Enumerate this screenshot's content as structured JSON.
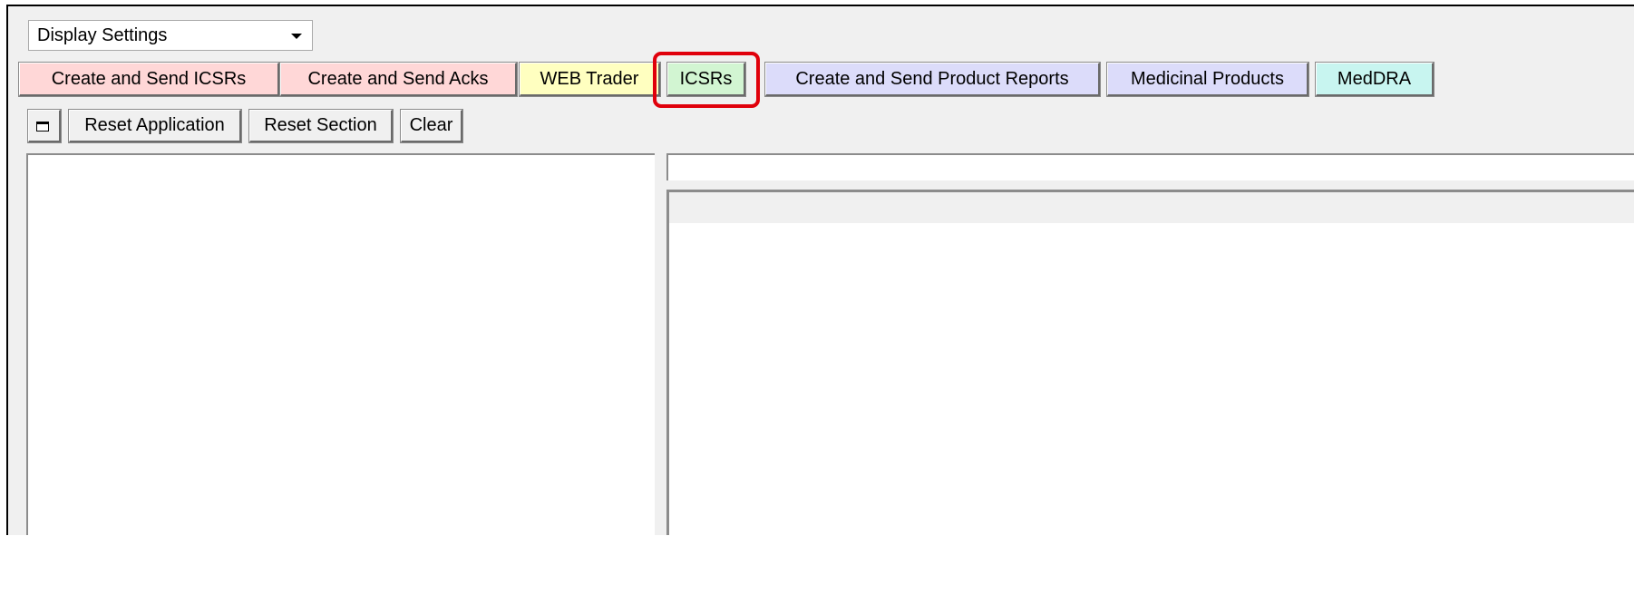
{
  "display_settings": {
    "selected": "Display Settings"
  },
  "tabs": [
    {
      "label": "Create and Send ICSRs",
      "color": "#ffd7d7"
    },
    {
      "label": "Create and Send Acks",
      "color": "#ffd7d7"
    },
    {
      "label": "WEB Trader",
      "color": "#ffffc0"
    },
    {
      "label": "ICSRs",
      "color": "#d2f5d2",
      "highlighted": true
    },
    {
      "label": "Create and Send Product Reports",
      "color": "#dcdcfa"
    },
    {
      "label": "Medicinal Products",
      "color": "#dcdcfa"
    },
    {
      "label": "MedDRA",
      "color": "#c8f5f0"
    }
  ],
  "toolbar": {
    "restore_icon": "window-restore-icon",
    "reset_application": "Reset Application",
    "reset_section": "Reset Section",
    "clear": "Clear"
  },
  "highlight_color": "#e0000b"
}
